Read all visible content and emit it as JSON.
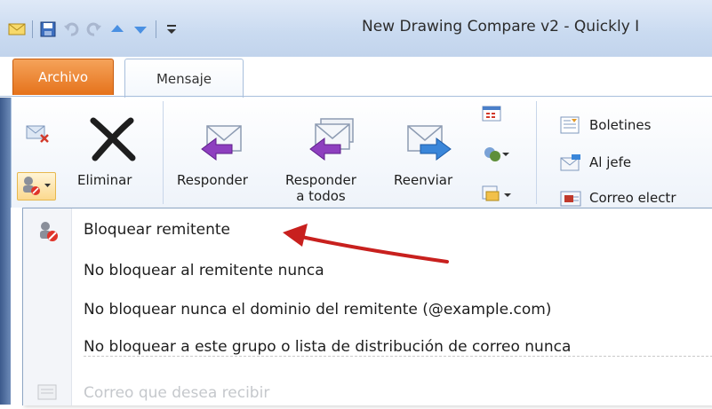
{
  "window": {
    "title": "New Drawing Compare v2 - Quickly I"
  },
  "tabs": [
    {
      "label": "Archivo",
      "active": false,
      "color": "#e5721b"
    },
    {
      "label": "Mensaje",
      "active": true
    }
  ],
  "ribbon": {
    "delete": {
      "label": "Eliminar"
    },
    "reply": {
      "label": "Responder"
    },
    "reply_all": {
      "label": "Responder\na todos",
      "line1": "Responder",
      "line2": "a todos"
    },
    "forward": {
      "label": "Reenviar"
    },
    "quick_steps": [
      "Boletines",
      "Al jefe",
      "Correo electr"
    ]
  },
  "junk_menu": {
    "items": [
      {
        "label": "Bloquear remitente",
        "enabled": true
      },
      {
        "label": "No bloquear al remitente nunca",
        "enabled": true
      },
      {
        "label": "No bloquear nunca el dominio del remitente (@example.com)",
        "enabled": true
      },
      {
        "label": "No bloquear a este grupo o lista de distribución de correo nunca",
        "enabled": true
      },
      {
        "label": "Correo que desea recibir",
        "enabled": false
      }
    ]
  },
  "annotation": {
    "arrow_color": "#c8201e"
  },
  "icons": [
    "mail-icon",
    "save-icon",
    "undo-icon",
    "redo-icon",
    "up-icon",
    "down-icon",
    "customize-icon",
    "ignore-icon",
    "delete-x-icon",
    "junk-icon",
    "reply-icon",
    "reply-all-icon",
    "forward-icon",
    "meeting-icon",
    "more-icon",
    "newsletter-icon",
    "to-manager-icon",
    "email-icon",
    "block-sender-icon",
    "safe-list-icon"
  ]
}
